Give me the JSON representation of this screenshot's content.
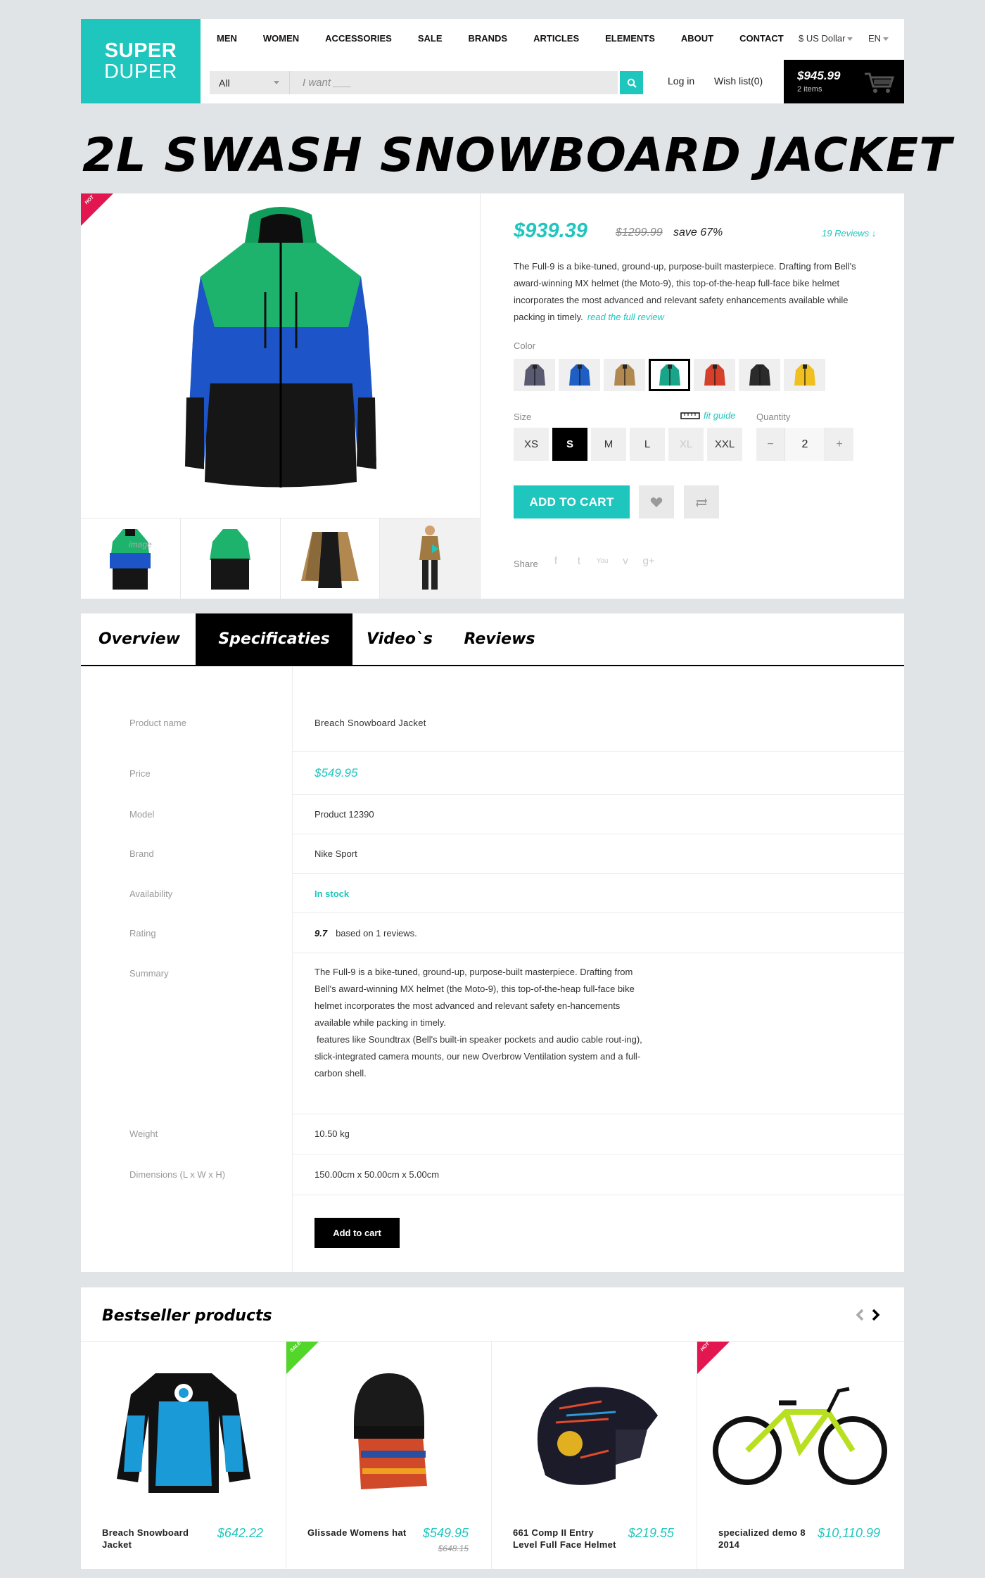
{
  "brand": {
    "line1": "SUPER",
    "line2": "DUPER"
  },
  "nav": [
    "MEN",
    "WOMEN",
    "ACCESSORIES",
    "SALE",
    "BRANDS",
    "ARTICLES",
    "ELEMENTS",
    "ABOUT",
    "CONTACT"
  ],
  "currency": "$ US Dollar",
  "language": "EN",
  "search": {
    "category": "All",
    "placeholder": "I want ___",
    "icon": "search-icon"
  },
  "account": {
    "login": "Log in",
    "wishlist": "Wish list(0)"
  },
  "cart": {
    "total": "$945.99",
    "items": "2 items",
    "icon": "cart-icon"
  },
  "product": {
    "title": "2L SWASH SNOWBOARD JACKET",
    "badge": "HOT",
    "price": "$939.39",
    "old_price": "$1299.99",
    "save": "save 67%",
    "reviews_link": "19 Reviews ↓",
    "description": "The Full-9 is a bike-tuned, ground-up, purpose-built masterpiece. Drafting from Bell's award-winning MX helmet (the Moto-9), this top-of-the-heap full-face bike helmet incorporates the most advanced and relevant safety enhancements available while packing in timely.",
    "read_more": "read the full review",
    "thumb_overlay": "image",
    "color_label": "Color",
    "colors": [
      "#5a5a73",
      "#1f5fc4",
      "#b08850",
      "#1aa58a",
      "#d6402a",
      "#2b2b2b",
      "#f0c020"
    ],
    "selected_color_index": 3,
    "size_label": "Size",
    "fit_guide": "fit guide",
    "sizes": [
      "XS",
      "S",
      "M",
      "L",
      "XL",
      "XXL"
    ],
    "selected_size": "S",
    "disabled_size": "XL",
    "quantity_label": "Quantity",
    "quantity": "2",
    "qty_minus": "−",
    "qty_plus": "+",
    "add_to_cart": "ADD TO CART",
    "share_label": "Share",
    "share": [
      "f",
      "t",
      "You",
      "v",
      "g+"
    ]
  },
  "tabs": [
    "Overview",
    "Specificaties",
    "Video`s",
    "Reviews"
  ],
  "active_tab": "Specificaties",
  "specs": {
    "product_name_key": "Product name",
    "product_name": "Breach Snowboard Jacket",
    "price_key": "Price",
    "price": "$549.95",
    "model_key": "Model",
    "model": "Product 12390",
    "brand_key": "Brand",
    "brand": "Nike Sport",
    "availability_key": "Availability",
    "availability": "In stock",
    "rating_key": "Rating",
    "rating": "9.7",
    "rating_text": "based on 1 reviews.",
    "summary_key": "Summary",
    "summary_1": "The Full-9 is a bike-tuned, ground-up, purpose-built masterpiece. Drafting from Bell's award-winning MX helmet (the Moto-9), this top-of-the-heap full-face bike helmet incorporates the most advanced and relevant safety en-hancements available while packing in timely.",
    "summary_2": "features like Soundtrax (Bell's built-in speaker pockets and audio cable rout-ing), slick-integrated camera mounts, our new Overbrow Ventilation system and a full-carbon shell.",
    "weight_key": "Weight",
    "weight": "10.50 kg",
    "dimensions_key": "Dimensions (L x W x H)",
    "dimensions": "150.00cm x 50.00cm x 5.00cm",
    "add_button": "Add to cart"
  },
  "bestsellers": {
    "title": "Bestseller products",
    "items": [
      {
        "name": "Breach Snowboard Jacket",
        "price": "$642.22",
        "old_price": "",
        "badge": ""
      },
      {
        "name": "Glissade Womens hat",
        "price": "$549.95",
        "old_price": "$648.15",
        "badge": "SALE"
      },
      {
        "name": "661 Comp II Entry Level Full Face Helmet",
        "price": "$219.55",
        "old_price": "",
        "badge": ""
      },
      {
        "name": "specialized demo 8 2014",
        "price": "$10,110.99",
        "old_price": "",
        "badge": "HOT"
      }
    ]
  },
  "badge_colors": {
    "hot": "#e3174f",
    "sale": "#52d62a"
  },
  "accent_color": "#1ec6be"
}
